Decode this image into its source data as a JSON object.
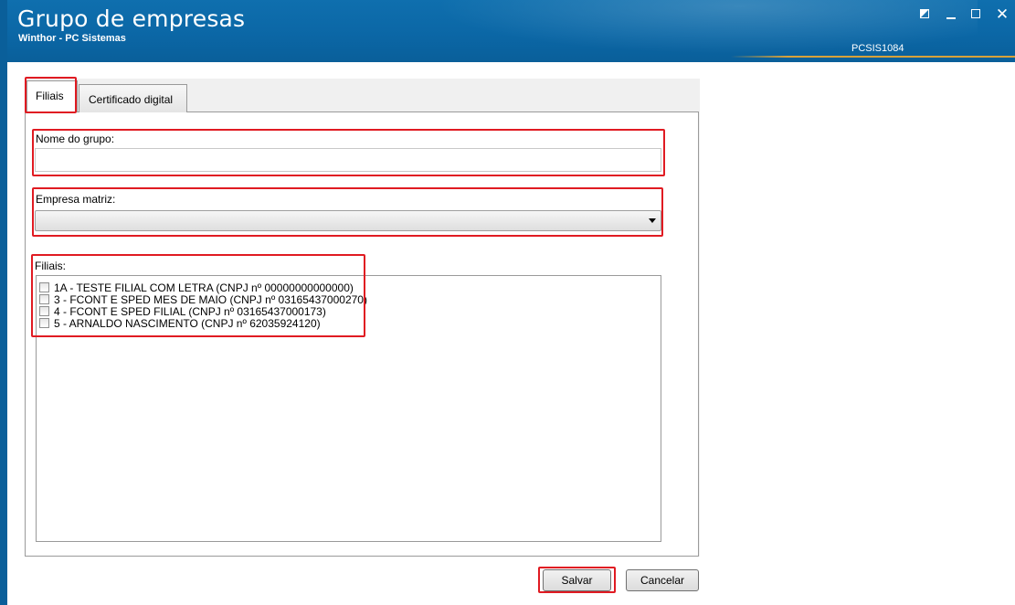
{
  "window": {
    "title": "Grupo de empresas",
    "subtitle": "Winthor - PC Sistemas",
    "code": "PCSIS1084",
    "close_glyph": "✕"
  },
  "tabs": [
    {
      "label": "Filiais",
      "active": true
    },
    {
      "label": "Certificado digital",
      "active": false
    }
  ],
  "form": {
    "group_name_label": "Nome do grupo:",
    "group_name_value": "",
    "matrix_label": "Empresa matriz:",
    "matrix_value": "",
    "branches_label": "Filiais:",
    "branches": [
      {
        "text": "1A - TESTE FILIAL COM LETRA (CNPJ nº 00000000000000)",
        "checked": false
      },
      {
        "text": "3 - FCONT E SPED MES DE MAIO (CNPJ nº 03165437000270)",
        "checked": false
      },
      {
        "text": "4 - FCONT E SPED FILIAL (CNPJ nº 03165437000173)",
        "checked": false
      },
      {
        "text": "5 - ARNALDO NASCIMENTO (CNPJ nº 62035924120)",
        "checked": false
      }
    ]
  },
  "buttons": {
    "save": "Salvar",
    "cancel": "Cancelar"
  },
  "colors": {
    "titlebar": "#0b67a6",
    "highlight": "#e01b22",
    "accent_line": "#d7a23a"
  }
}
